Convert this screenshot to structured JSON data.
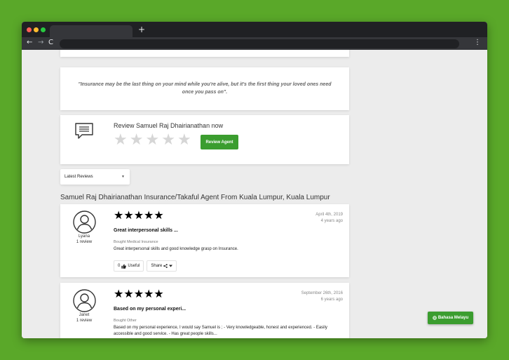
{
  "browser": {
    "new_tab_glyph": "+",
    "back_glyph": "←",
    "forward_glyph": "→",
    "reload_glyph": "C",
    "menu_glyph": "⋮"
  },
  "quote": {
    "text": "\"Insurance may be the last thing on your mind while you're alive, but it's the first thing your loved ones need once you pass on\"."
  },
  "review_now": {
    "title": "Review Samuel Raj Dhairianathan now",
    "button_label": "Review Agent",
    "empty_star_glyph": "★",
    "icon": "chat-icon"
  },
  "sort": {
    "selected": "Latest Reviews",
    "caret": "▼"
  },
  "section_heading": "Samuel Raj Dhairianathan Insurance/Takaful Agent From Kuala Lumpur, Kuala Lumpur",
  "reviews": [
    {
      "author": "Lyana",
      "review_count": "1 review",
      "rating": 5,
      "stars": "★★★★★",
      "date": "April 4th, 2019",
      "ago": "4 years ago",
      "title": "Great interpersonal skills ...",
      "bought": "Bought Medical Insurance",
      "text": "Great interpersonal skills and good knowledge grasp on Insurance.",
      "useful_count": "0",
      "useful_label": "Useful",
      "share_label": "Share"
    },
    {
      "author": "Janet",
      "review_count": "1 review",
      "rating": 5,
      "stars": "★★★★★",
      "date": "September 26th, 2016",
      "ago": "6 years ago",
      "title": "Based on my personal experi...",
      "bought": "Bought Other",
      "text": "Based on my personal experience, I would say Samuel is ; - Very knowledgeable, honest and experienced. - Easily accessible and good service. - Has great people skills..."
    }
  ],
  "language_button": {
    "label": "Bahasa Melayu"
  },
  "colors": {
    "accent_green": "#3b9d2f",
    "star_gold": "#f5b800",
    "star_empty": "#d6d6d6",
    "background_green": "#5aa829"
  }
}
